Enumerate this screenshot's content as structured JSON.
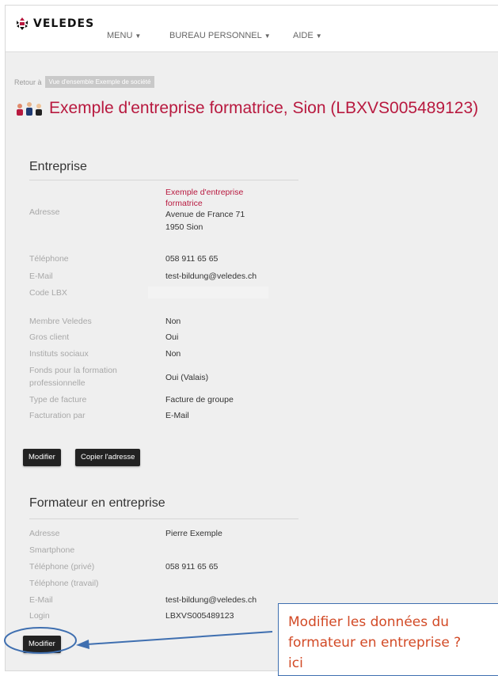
{
  "nav": {
    "logo_text": "VELEDES",
    "menu": "MENU",
    "bureau": "BUREAU PERSONNEL",
    "aide": "AIDE"
  },
  "breadcrumb": {
    "prefix": "Retour à",
    "link": "Vue d'ensemble Exemple de société"
  },
  "page_title": "Exemple d'entreprise formatrice, Sion (LBXVS005489123)",
  "entreprise": {
    "heading": "Entreprise",
    "adresse_label": "Adresse",
    "adresse_name_1": "Exemple d'entreprise",
    "adresse_name_2": "formatrice",
    "adresse_street": "Avenue de France 71",
    "adresse_city": "1950 Sion",
    "telephone_label": "Téléphone",
    "telephone": "058 911 65 65",
    "email_label": "E-Mail",
    "email": "test-bildung@veledes.ch",
    "code_label": "Code LBX",
    "membre_label": "Membre Veledes",
    "membre": "Non",
    "gros_label": "Gros client",
    "gros": "Oui",
    "instituts_label": "Instituts sociaux",
    "instituts": "Non",
    "fonds_label_1": "Fonds pour la formation",
    "fonds_label_2": "professionnelle",
    "fonds": "Oui (Valais)",
    "type_label": "Type de facture",
    "type": "Facture de groupe",
    "facturation_label": "Facturation par",
    "facturation": "E-Mail",
    "modify_button": "Modifier",
    "copy_button": "Copier l'adresse"
  },
  "formateur": {
    "heading": "Formateur en entreprise",
    "adresse_label": "Adresse",
    "adresse": "Pierre Exemple",
    "smartphone_label": "Smartphone",
    "tel_prive_label": "Téléphone (privé)",
    "tel_prive": "058 911 65 65",
    "tel_travail_label": "Téléphone (travail)",
    "email_label": "E-Mail",
    "email": "test-bildung@veledes.ch",
    "login_label": "Login",
    "login": "LBXVS005489123",
    "modify_button": "Modifier"
  },
  "callout": {
    "line1": "Modifier les données du",
    "line2": "formateur en entreprise ?",
    "line3": "ici"
  },
  "colors": {
    "accent_red": "#b8193f",
    "callout_blue": "#3f6fb0",
    "callout_text": "#d24a26"
  }
}
